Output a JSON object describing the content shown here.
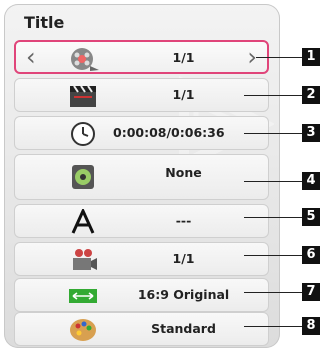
{
  "header": {
    "title": "Title"
  },
  "rows": [
    {
      "value": "1/1",
      "icon": "film-reel-icon",
      "callout": "1"
    },
    {
      "value": "1/1",
      "icon": "clapperboard-icon",
      "callout": "2"
    },
    {
      "value": "0:00:08/0:06:36",
      "icon": "clock-icon",
      "callout": "3"
    },
    {
      "value": "None",
      "icon": "speaker-icon",
      "callout": "4"
    },
    {
      "value": "---",
      "icon": "subtitle-letter-a-icon",
      "callout": "5"
    },
    {
      "value": "1/1",
      "icon": "camera-angle-icon",
      "callout": "6"
    },
    {
      "value": "16:9 Original",
      "icon": "aspect-ratio-icon",
      "callout": "7"
    },
    {
      "value": "Standard",
      "icon": "picture-mode-palette-icon",
      "callout": "8"
    }
  ],
  "arrows": {
    "left": "‹",
    "right": "›"
  },
  "colors": {
    "selection": "#e0457a",
    "callout_bg": "#111111"
  }
}
